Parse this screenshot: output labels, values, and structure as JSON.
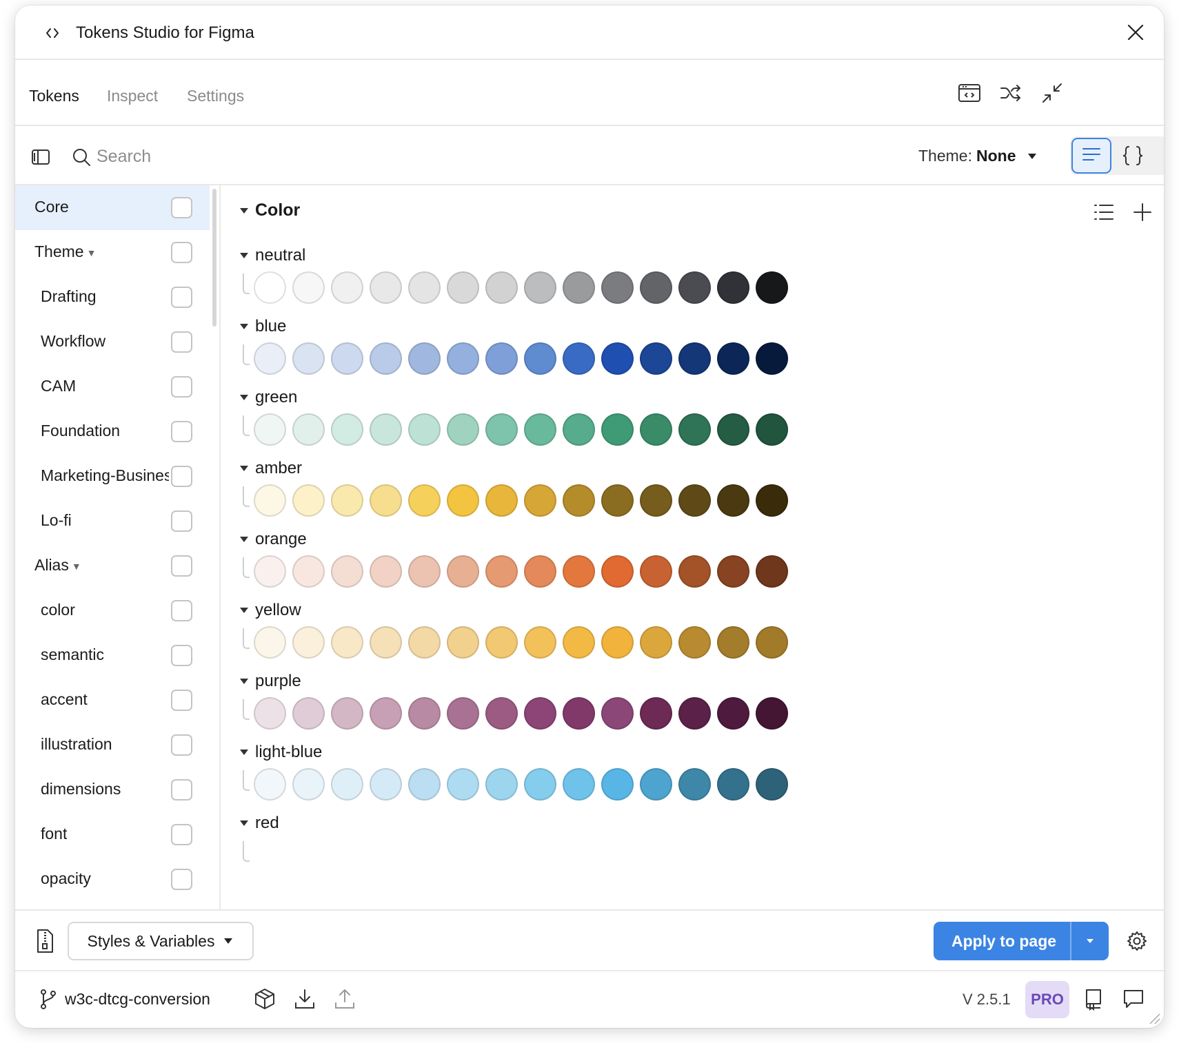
{
  "app": {
    "title": "Tokens Studio for Figma"
  },
  "tabs": [
    {
      "label": "Tokens",
      "active": true
    },
    {
      "label": "Inspect",
      "active": false
    },
    {
      "label": "Settings",
      "active": false
    }
  ],
  "toolbar": {
    "search_placeholder": "Search",
    "theme_label": "Theme:",
    "theme_value": "None"
  },
  "sidebar": {
    "items": [
      {
        "label": "Core",
        "selected": true,
        "indent": false,
        "caret": false
      },
      {
        "label": "Theme",
        "selected": false,
        "indent": false,
        "caret": true
      },
      {
        "label": "Drafting",
        "selected": false,
        "indent": true,
        "caret": false
      },
      {
        "label": "Workflow",
        "selected": false,
        "indent": true,
        "caret": false
      },
      {
        "label": "CAM",
        "selected": false,
        "indent": true,
        "caret": false
      },
      {
        "label": "Foundation",
        "selected": false,
        "indent": true,
        "caret": false
      },
      {
        "label": "Marketing-Business",
        "selected": false,
        "indent": true,
        "caret": false
      },
      {
        "label": "Lo-fi",
        "selected": false,
        "indent": true,
        "caret": false
      },
      {
        "label": "Alias",
        "selected": false,
        "indent": false,
        "caret": true
      },
      {
        "label": "color",
        "selected": false,
        "indent": true,
        "caret": false
      },
      {
        "label": "semantic",
        "selected": false,
        "indent": true,
        "caret": false
      },
      {
        "label": "accent",
        "selected": false,
        "indent": true,
        "caret": false
      },
      {
        "label": "illustration",
        "selected": false,
        "indent": true,
        "caret": false
      },
      {
        "label": "dimensions",
        "selected": false,
        "indent": true,
        "caret": false
      },
      {
        "label": "font",
        "selected": false,
        "indent": true,
        "caret": false
      },
      {
        "label": "opacity",
        "selected": false,
        "indent": true,
        "caret": false
      }
    ]
  },
  "main": {
    "group_title": "Color",
    "color_groups": [
      {
        "name": "neutral",
        "swatches": [
          "#ffffff",
          "#f7f7f7",
          "#f0f0f0",
          "#e8e8e8",
          "#e4e4e4",
          "#d9d9d9",
          "#d2d2d2",
          "#bcbdbf",
          "#9a9b9d",
          "#7b7c7f",
          "#636468",
          "#4a4c52",
          "#303238",
          "#17181a"
        ]
      },
      {
        "name": "blue",
        "swatches": [
          "#e9eef7",
          "#dae3f2",
          "#cdd9ef",
          "#b9cbe8",
          "#a0b8df",
          "#93b0de",
          "#7f9fd8",
          "#5f8bd0",
          "#3a6bc4",
          "#1f4fb1",
          "#1c4696",
          "#143778",
          "#0c2757",
          "#071a3c"
        ]
      },
      {
        "name": "green",
        "swatches": [
          "#f0f6f3",
          "#e1f0ea",
          "#d2ebe3",
          "#c8e6db",
          "#bee1d5",
          "#9fd3c0",
          "#7ec3ab",
          "#69b99d",
          "#56ac8c",
          "#3f9b76",
          "#3a8c69",
          "#2f7456",
          "#245c44",
          "#21553e"
        ]
      },
      {
        "name": "amber",
        "swatches": [
          "#fdf8e5",
          "#fcf1c8",
          "#fae9ad",
          "#f7de8e",
          "#f5d15c",
          "#f2c440",
          "#e8b63a",
          "#d6a636",
          "#b48d2a",
          "#8b6d22",
          "#765d1d",
          "#5f4a17",
          "#4a3911",
          "#3a2b0b"
        ]
      },
      {
        "name": "orange",
        "swatches": [
          "#faf1ee",
          "#f7e7e0",
          "#f4ddd3",
          "#f1d2c5",
          "#ecc3b0",
          "#e8b093",
          "#e59a72",
          "#e4895a",
          "#e3783f",
          "#e06a31",
          "#c96232",
          "#a45228",
          "#874322",
          "#6f371c"
        ]
      },
      {
        "name": "yellow",
        "swatches": [
          "#fcf6ea",
          "#fbf0dc",
          "#f8e8c7",
          "#f5e0b8",
          "#f3d9a5",
          "#f2d08e",
          "#f2c872",
          "#f2c15a",
          "#f2ba45",
          "#f1b33c",
          "#dba73c",
          "#b88b31",
          "#a37d2b",
          "#a27b2a"
        ]
      },
      {
        "name": "purple",
        "swatches": [
          "#ede1e8",
          "#e0ccd7",
          "#d4b7c5",
          "#c8a0b5",
          "#b98aa4",
          "#a97194",
          "#9c5b82",
          "#8c4576",
          "#81396a",
          "#8a4777",
          "#6c2a55",
          "#5c2148",
          "#4e1a3e",
          "#441634"
        ]
      },
      {
        "name": "light-blue",
        "swatches": [
          "#f1f7fb",
          "#e8f3fa",
          "#dfeff8",
          "#d4eaf6",
          "#bcdef2",
          "#addbf1",
          "#9dd4ee",
          "#85cdec",
          "#6fc3eb",
          "#58b6e6",
          "#4da4cf",
          "#3f87a9",
          "#34718d",
          "#2e6279"
        ]
      },
      {
        "name": "red",
        "swatches": []
      }
    ]
  },
  "bottom": {
    "styles_label": "Styles & Variables",
    "apply_label": "Apply to page"
  },
  "footer": {
    "branch": "w3c-dtcg-conversion",
    "version": "V 2.5.1",
    "pro_badge": "PRO"
  },
  "colors": {
    "accent": "#3b84e3",
    "selected_bg": "#e6f0fd",
    "pro_bg": "#e4dcf6",
    "pro_text": "#6a48b8"
  }
}
